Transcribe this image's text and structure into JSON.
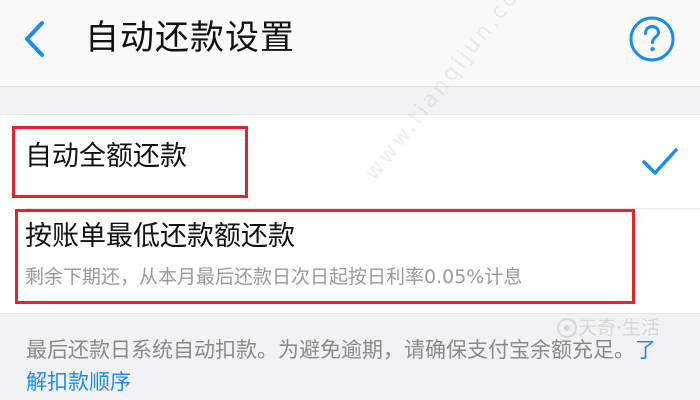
{
  "header": {
    "title": "自动还款设置"
  },
  "options": [
    {
      "label": "自动全额还款",
      "selected": true
    },
    {
      "label": "按账单最低还款额还款",
      "description": "剩余下期还，从本月最后还款日次日起按日利率0.05%计息",
      "selected": false
    }
  ],
  "footer": {
    "note": "最后还款日系统自动扣款。为避免逾期，请确保支付宝余额充足。",
    "link_label": "了解扣款顺序"
  },
  "watermark": {
    "diagonal_text": "www.tianqijun.com",
    "logo_text": "天奇·生活"
  },
  "colors": {
    "accent_blue": "#1a8cf0",
    "highlight_red": "#e0252b"
  },
  "icons": {
    "back": "chevron-left-icon",
    "help": "question-circle-icon",
    "selected": "checkmark-icon"
  }
}
